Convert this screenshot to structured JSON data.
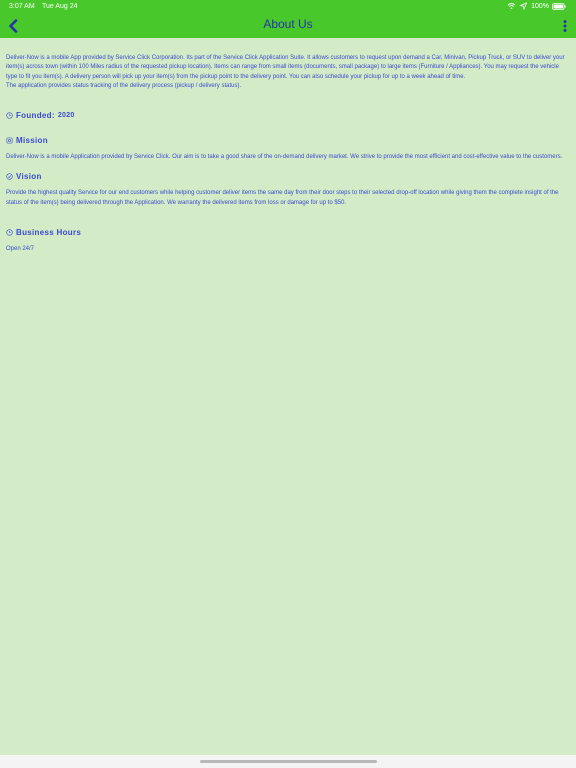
{
  "status_bar": {
    "time": "3:07 AM",
    "date": "Tue Aug 24",
    "battery": "100%"
  },
  "header": {
    "title": "About Us"
  },
  "about": {
    "intro_line1": "Deliver-Now is a mobile App provided by Service Click Corporation. Its part of the Service Click Application Suite. It allows customers to request upon demand a Car, Minivan, Pickup Truck, or SUV to deliver your",
    "intro_line2": "item(s) across town (within 100 Miles radius of the requested pickup location). Items can range from small items (documents, small package) to large items (Furniture / Appliances). You may request the vehicle",
    "intro_line3": "type to fit you item(s). A delivery person will pick up your item(s) from the pickup point to the delivery point. You can also schedule your pickup for up to a week ahead of time.",
    "intro_line4": "The application provides status tracking  of the delivery process (pickup / delivery status)."
  },
  "founded": {
    "label": "Founded:",
    "year": "2020"
  },
  "mission": {
    "heading": "Mission",
    "text": "Deliver-Now is a mobile Application provided by Service Click. Our aim is to take a good share of the on-demand delivery market. We strive to provide the most efficient and cost-effective value to the customers."
  },
  "vision": {
    "heading": "Vision",
    "line1": "Provide the highest quality Service for our end customers while helping customer deliver items the same day from their door steps to their selected drop-off location while giving them the complete insight of the",
    "line2": "status of the item(s) being delivered through the Application. We warranty the delivered items from loss or damage for up to $50."
  },
  "business_hours": {
    "heading": "Business Hours",
    "text": "Open 24/7"
  },
  "colors": {
    "topbar": "#49c82c",
    "background": "#d3ebc6",
    "text": "#3b4bd0",
    "title": "#2733a8"
  },
  "icons": {
    "back": "chevron-left-icon",
    "menu": "more-vertical-icon",
    "founded": "clock-icon",
    "mission": "target-icon",
    "vision": "eye-icon",
    "hours": "clock-icon"
  }
}
